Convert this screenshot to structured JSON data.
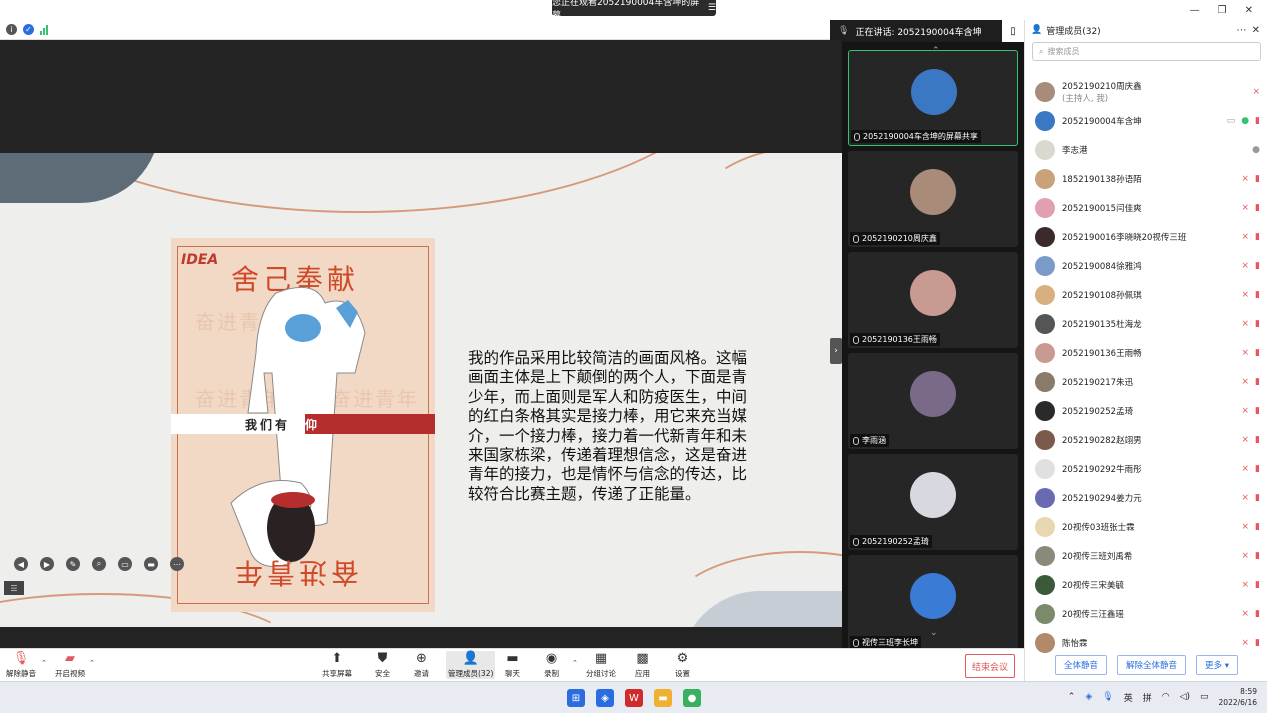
{
  "banner": {
    "text": "您正在观看2052190004车含坤的屏幕",
    "icon": "menu-icon"
  },
  "speaking": {
    "text": "正在讲话: 2052190004车含坤"
  },
  "slide": {
    "poster": {
      "logo": "IDEA",
      "top_title": "舍己奉献",
      "watermark": "奋进青年",
      "banner_text_dark": "我们有",
      "banner_text_red": "信仰",
      "bottom_title": "奋进青年"
    },
    "text": "我的作品采用比较简洁的画面风格。这幅画面主体是上下颠倒的两个人，下面是青少年，而上面则是军人和防疫医生，中间的红白条格其实是接力棒，用它来充当媒介，一个接力棒，接力着一代新青年和未来国家栋梁，传递着理想信念，这是奋进青年的接力，也是情怀与信念的传达，比较符合比赛主题，传递了正能量。"
  },
  "videos": [
    {
      "name": "2052190004车含坤的屏幕共享",
      "color": "#3a78c4",
      "active": true
    },
    {
      "name": "2052190210周庆鑫",
      "color": "#a88b78",
      "active": false
    },
    {
      "name": "2052190136王雨畅",
      "color": "#c89a92",
      "active": false
    },
    {
      "name": "李雨涵",
      "color": "#7a6a8a",
      "active": false
    },
    {
      "name": "2052190252孟琦",
      "color": "#d8d8e0",
      "active": false
    },
    {
      "name": "视传三班李长坤",
      "color": "#3a7bd5",
      "active": false
    }
  ],
  "participants_panel": {
    "title": "管理成员(32)",
    "search_placeholder": "搜索成员",
    "members": [
      {
        "name": "2052190210周庆鑫",
        "sub": "(主持人, 我)",
        "color": "#a88b78"
      },
      {
        "name": "2052190004车含坤",
        "sub": "",
        "color": "#3a78c4"
      },
      {
        "name": "李志港",
        "sub": "",
        "color": "#d9d9d0"
      },
      {
        "name": "1852190138孙语陌",
        "sub": "",
        "color": "#c9a27a"
      },
      {
        "name": "2052190015闫佳爽",
        "sub": "",
        "color": "#e0a0b0"
      },
      {
        "name": "2052190016李晓晓20视传三班",
        "sub": "",
        "color": "#3a2a2a"
      },
      {
        "name": "2052190084徐雅鸿",
        "sub": "",
        "color": "#7a9ac8"
      },
      {
        "name": "2052190108孙佩琪",
        "sub": "",
        "color": "#d8b080"
      },
      {
        "name": "2052190135杜海龙",
        "sub": "",
        "color": "#555555"
      },
      {
        "name": "2052190136王雨畅",
        "sub": "",
        "color": "#c89a92"
      },
      {
        "name": "2052190217朱迅",
        "sub": "",
        "color": "#8a7a6a"
      },
      {
        "name": "2052190252孟琦",
        "sub": "",
        "color": "#2a2a2a"
      },
      {
        "name": "2052190282赵翊男",
        "sub": "",
        "color": "#7a5a4a"
      },
      {
        "name": "2052190292牛雨彤",
        "sub": "",
        "color": "#e0e0e0"
      },
      {
        "name": "2052190294姜力元",
        "sub": "",
        "color": "#6a6ab0"
      },
      {
        "name": "20视传03班张士霖",
        "sub": "",
        "color": "#e8d8b0"
      },
      {
        "name": "20视传三班刘禹希",
        "sub": "",
        "color": "#8a8a7a"
      },
      {
        "name": "20视传三宋美毓",
        "sub": "",
        "color": "#3a5a3a"
      },
      {
        "name": "20视传三汪鑫瑶",
        "sub": "",
        "color": "#7a8a6a"
      },
      {
        "name": "陈怡霖",
        "sub": "",
        "color": "#b08a6a"
      }
    ],
    "buttons": [
      "全体静音",
      "解除全体静音",
      "更多 ▾"
    ]
  },
  "toolbar": {
    "items": [
      {
        "label": "解除静音",
        "icon": "mic-muted-icon"
      },
      {
        "label": "开启视频",
        "icon": "camera-off-icon"
      },
      {
        "label": "共享屏幕",
        "icon": "share-screen-icon"
      },
      {
        "label": "安全",
        "icon": "shield-icon"
      },
      {
        "label": "邀请",
        "icon": "invite-icon"
      },
      {
        "label": "管理成员(32)",
        "icon": "members-icon"
      },
      {
        "label": "聊天",
        "icon": "chat-icon"
      },
      {
        "label": "录制",
        "icon": "record-icon"
      },
      {
        "label": "分组讨论",
        "icon": "breakout-icon"
      },
      {
        "label": "应用",
        "icon": "apps-icon"
      },
      {
        "label": "设置",
        "icon": "settings-icon"
      }
    ],
    "end": "结束会议"
  },
  "taskbar": {
    "ime1": "英",
    "ime2": "拼",
    "time": "8:59",
    "date": "2022/6/16"
  }
}
